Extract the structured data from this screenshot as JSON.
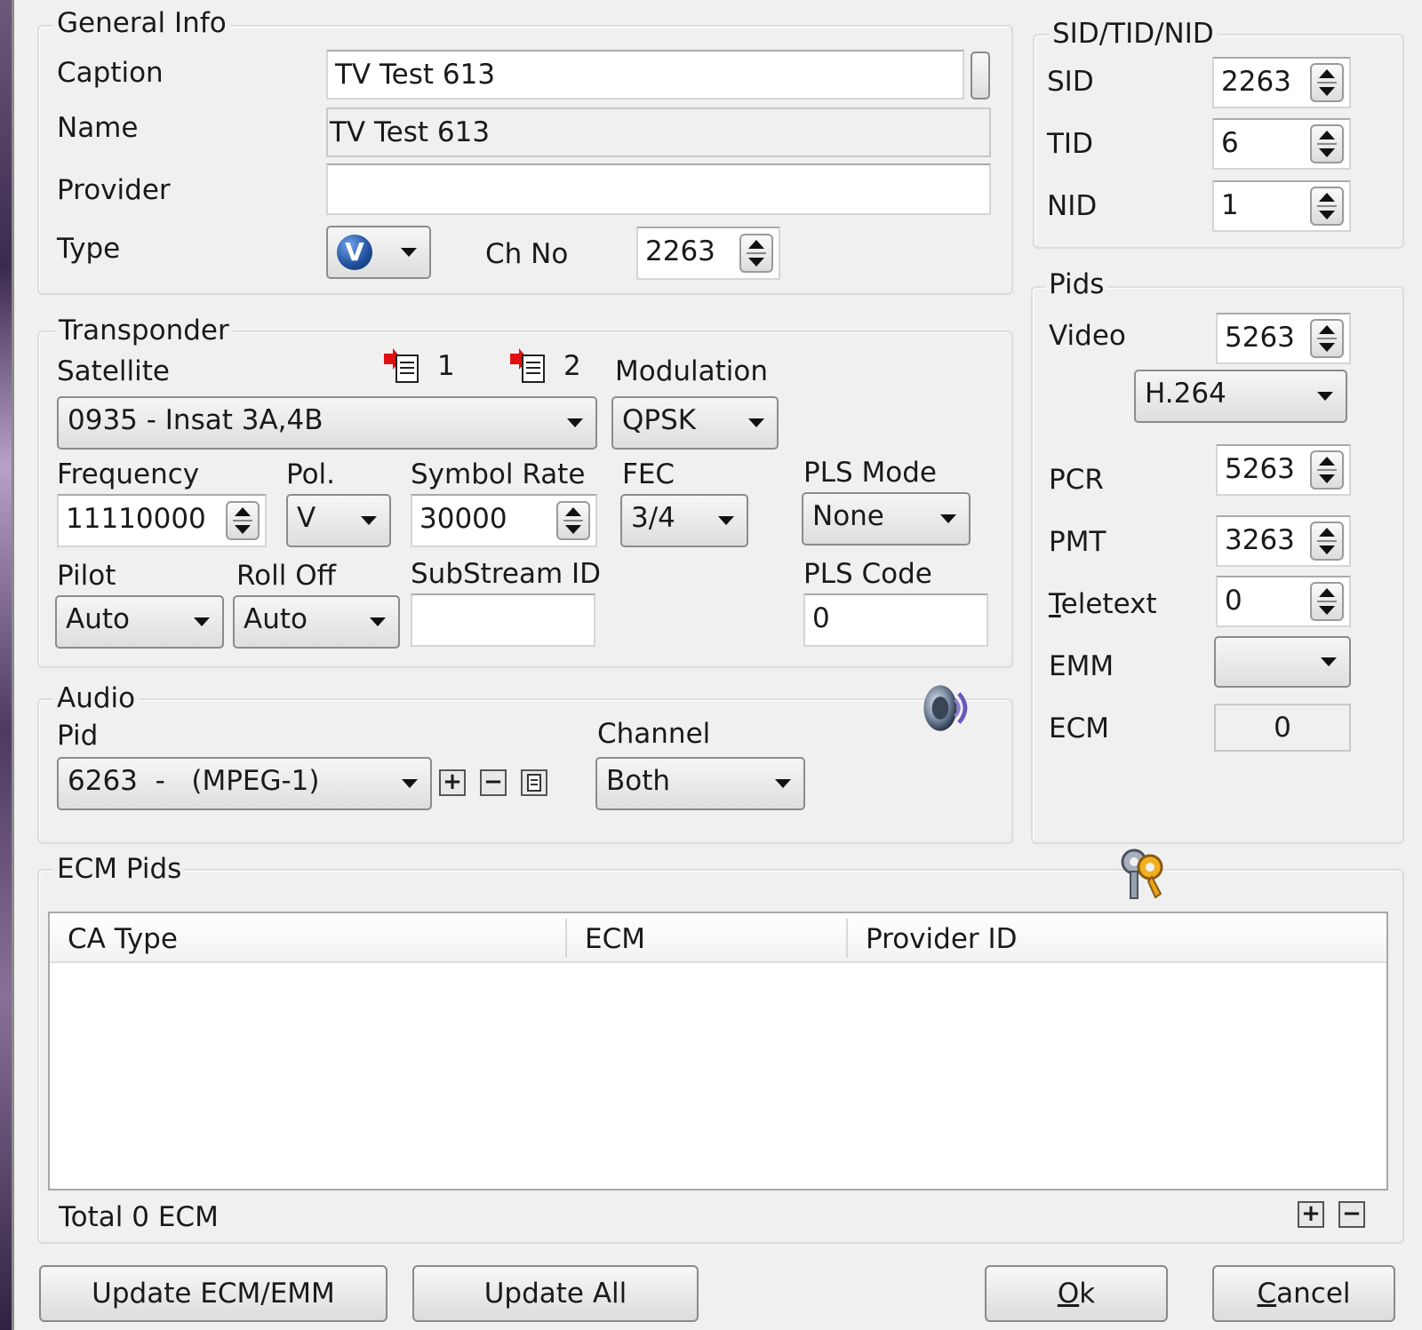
{
  "general_info": {
    "title": "General Info",
    "caption_label": "Caption",
    "caption_value": "TV Test 613",
    "name_label": "Name",
    "name_value": "TV Test 613",
    "provider_label": "Provider",
    "provider_value": "",
    "type_label": "Type",
    "type_icon": "video-v-icon",
    "type_icon_letter": "V",
    "chno_label": "Ch No",
    "chno_value": "2263"
  },
  "sid_tid_nid": {
    "title": "SID/TID/NID",
    "sid_label": "SID",
    "sid_value": "2263",
    "tid_label": "TID",
    "tid_value": "6",
    "nid_label": "NID",
    "nid_value": "1"
  },
  "transponder": {
    "title": "Transponder",
    "satellite_label": "Satellite",
    "tp1_label": "1",
    "tp2_label": "2",
    "satellite_value": "0935 - Insat 3A,4B",
    "modulation_label": "Modulation",
    "modulation_value": "QPSK",
    "frequency_label": "Frequency",
    "frequency_value": "11110000",
    "pol_label": "Pol.",
    "pol_value": "V",
    "symbol_rate_label": "Symbol Rate",
    "symbol_rate_value": "30000",
    "fec_label": "FEC",
    "fec_value": "3/4",
    "pls_mode_label": "PLS Mode",
    "pls_mode_value": "None",
    "pilot_label": "Pilot",
    "pilot_value": "Auto",
    "rolloff_label": "Roll Off",
    "rolloff_value": "Auto",
    "substream_label": "SubStream ID",
    "substream_value": "",
    "pls_code_label": "PLS Code",
    "pls_code_value": "0"
  },
  "pids": {
    "title": "Pids",
    "video_label": "Video",
    "video_value": "5263",
    "codec_value": "H.264",
    "pcr_label": "PCR",
    "pcr_value": "5263",
    "pmt_label": "PMT",
    "pmt_value": "3263",
    "teletext_label_first": "T",
    "teletext_label_rest": "eletext",
    "teletext_value": "0",
    "emm_label": "EMM",
    "emm_value": "",
    "ecm_label": "ECM",
    "ecm_value": "0"
  },
  "audio": {
    "title": "Audio",
    "pid_label": "Pid",
    "pid_value": "6263  -   (MPEG-1)",
    "channel_label": "Channel",
    "channel_value": "Both",
    "add_symbol": "+",
    "remove_symbol": "−"
  },
  "ecm_pids": {
    "title": "ECM Pids",
    "columns": [
      "CA Type",
      "ECM",
      "Provider ID"
    ],
    "rows": [],
    "total_text": "Total 0 ECM",
    "add_symbol": "+",
    "remove_symbol": "−"
  },
  "buttons": {
    "update_ecm_emm": "Update ECM/EMM",
    "update_all": "Update All",
    "ok_first": "O",
    "ok_rest": "k",
    "cancel_first": "C",
    "cancel_rest": "ancel"
  },
  "colors": {
    "window_bg": "#f0f0f0",
    "marker_red": "#e01010",
    "icon_blue": "#1e4f9c"
  }
}
